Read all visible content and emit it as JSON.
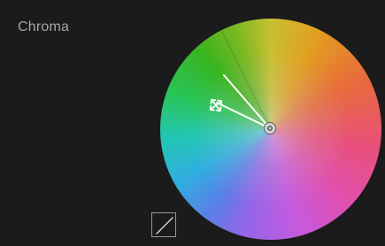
{
  "panel": {
    "title": "Chroma"
  },
  "icons": {
    "move_handle": "four-way-arrow-icon",
    "center_point": "center-target-icon",
    "curve_toggle": "diagonal-curve-icon"
  },
  "colors": {
    "background": "#1b1b1b",
    "title_text": "#a6a6a6",
    "control_line": "#ffffff",
    "button_border": "#9a9a9a"
  }
}
